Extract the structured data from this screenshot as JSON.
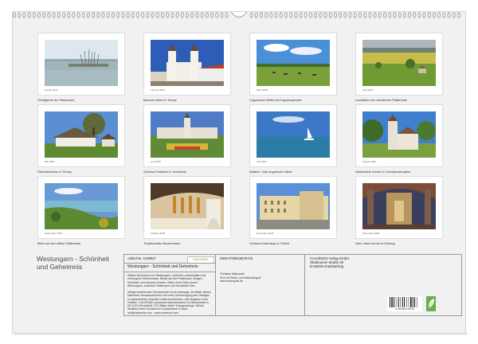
{
  "calendar": {
    "title": "Westungarn - Schönheit und Geheimnis",
    "months": [
      {
        "caption": "Schilfgürtel am Plattensee",
        "month_label": "Januar 2025",
        "scene": "lake"
      },
      {
        "caption": "Barocke Abtei in Tihany",
        "month_label": "Februar 2025",
        "scene": "abbey"
      },
      {
        "caption": "Ungarische Büffel bei Kápolnapuszta",
        "month_label": "März 2025",
        "scene": "meadow"
      },
      {
        "caption": "Landleben am westlichen Plattensee",
        "month_label": "April 2025",
        "scene": "fields"
      },
      {
        "caption": "Reetdachhaus in Tihany",
        "month_label": "Mai 2025",
        "scene": "cottage"
      },
      {
        "caption": "Schloss Festetics in Keszthely",
        "month_label": "Juni 2025",
        "scene": "palace"
      },
      {
        "caption": "Balaton: Das ungarische Meer",
        "month_label": "Juli 2025",
        "scene": "sail"
      },
      {
        "caption": "Historische Kirche in Csempeszkopács",
        "month_label": "August 2025",
        "scene": "church"
      },
      {
        "caption": "Blick auf den stillen Plattensee",
        "month_label": "September 2025",
        "scene": "view"
      },
      {
        "caption": "Traditionelles Bauernhaus",
        "month_label": "Oktober 2025",
        "scene": "farmhouse"
      },
      {
        "caption": "Schloss Esterházy in Fertőd",
        "month_label": "November 2025",
        "scene": "esterhazy"
      },
      {
        "caption": "Herz-Jesu-Kirche in Kőszeg",
        "month_label": "Dezember 2025",
        "scene": "interior"
      }
    ]
  },
  "info_box": {
    "article_label": "Artikel-Nr. 2109927",
    "logo_text": "CALVENDO",
    "product_title": "Westungarn - Schönheit und Geheimnis",
    "description": "Wildes Schönsein von Westungarn, herrliche Landschaften und verborgene Geheimnisse. Blicke auf den Plattensee, Burgen, Schlösser und barocke Kirchen. Bilder einer Reise durch Westungarn, zwischen Plattensee und Neusiedler See.",
    "copyright_text": "Infolge bestehender Schutzrechte ist es untersagt, die Bilder dieses Kalenders herauszutrennen und ohne Genehmigung des Verlages zu gewerblichen Zwecken weiterzuverbreiten. Alle Angaben ohne Gewähr. CALVENDO produziert kalenderweise im Klimaneutral in DE & EU (Frankfurt) CO2 Bilanz liefert Transportwege. Abholt-Reaktion einer Druckerei in Deutschland. E-Mail: info@calvendo.com · www.calvendo.com",
    "isbn": "ISBN 9783516676733",
    "author": "Christian Malmqvist",
    "author_role": "Fine Art Reise- und Naturfotograf",
    "author_web": "www.malmqvist.de",
    "publisher_name": "CALVENDO Verlag GmbH",
    "publisher_street": "Ottobrunner Straße 39",
    "publisher_city": "D-82008 Unterhaching",
    "barcode_number": "9 783516 676733"
  }
}
